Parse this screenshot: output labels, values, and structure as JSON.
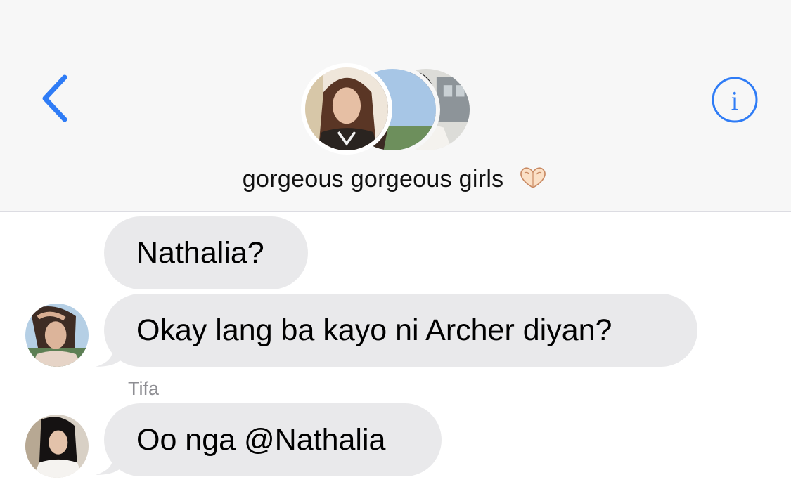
{
  "header": {
    "back_icon": "chevron-left-icon",
    "info_icon": "info-circle-icon",
    "info_glyph": "i",
    "group_name": "gorgeous gorgeous girls",
    "group_emoji": "heart-hands-emoji",
    "accent_color": "#2f7cf6"
  },
  "messages": [
    {
      "text": "Nathalia?"
    },
    {
      "text": "Okay lang ba kayo ni Archer diyan?"
    },
    {
      "sender": "Tifa",
      "text": "Oo nga @Nathalia"
    }
  ],
  "colors": {
    "header_bg": "#f7f7f7",
    "bubble_bg": "#e9e9eb",
    "sender_text": "#8e8e93"
  }
}
